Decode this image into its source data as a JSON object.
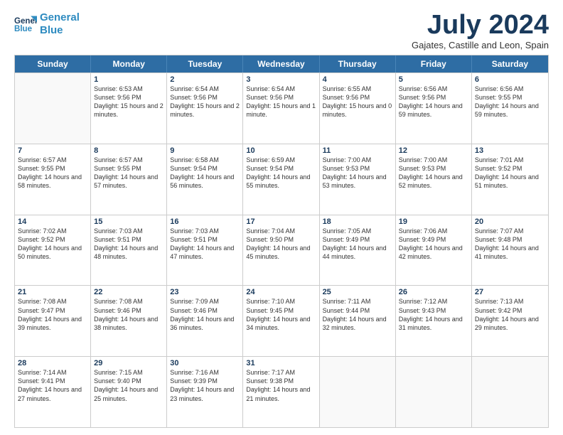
{
  "header": {
    "logo_line1": "General",
    "logo_line2": "Blue",
    "month_title": "July 2024",
    "location": "Gajates, Castille and Leon, Spain"
  },
  "weekdays": [
    "Sunday",
    "Monday",
    "Tuesday",
    "Wednesday",
    "Thursday",
    "Friday",
    "Saturday"
  ],
  "rows": [
    [
      {
        "day": "",
        "sunrise": "",
        "sunset": "",
        "daylight": ""
      },
      {
        "day": "1",
        "sunrise": "Sunrise: 6:53 AM",
        "sunset": "Sunset: 9:56 PM",
        "daylight": "Daylight: 15 hours and 2 minutes."
      },
      {
        "day": "2",
        "sunrise": "Sunrise: 6:54 AM",
        "sunset": "Sunset: 9:56 PM",
        "daylight": "Daylight: 15 hours and 2 minutes."
      },
      {
        "day": "3",
        "sunrise": "Sunrise: 6:54 AM",
        "sunset": "Sunset: 9:56 PM",
        "daylight": "Daylight: 15 hours and 1 minute."
      },
      {
        "day": "4",
        "sunrise": "Sunrise: 6:55 AM",
        "sunset": "Sunset: 9:56 PM",
        "daylight": "Daylight: 15 hours and 0 minutes."
      },
      {
        "day": "5",
        "sunrise": "Sunrise: 6:56 AM",
        "sunset": "Sunset: 9:56 PM",
        "daylight": "Daylight: 14 hours and 59 minutes."
      },
      {
        "day": "6",
        "sunrise": "Sunrise: 6:56 AM",
        "sunset": "Sunset: 9:55 PM",
        "daylight": "Daylight: 14 hours and 59 minutes."
      }
    ],
    [
      {
        "day": "7",
        "sunrise": "Sunrise: 6:57 AM",
        "sunset": "Sunset: 9:55 PM",
        "daylight": "Daylight: 14 hours and 58 minutes."
      },
      {
        "day": "8",
        "sunrise": "Sunrise: 6:57 AM",
        "sunset": "Sunset: 9:55 PM",
        "daylight": "Daylight: 14 hours and 57 minutes."
      },
      {
        "day": "9",
        "sunrise": "Sunrise: 6:58 AM",
        "sunset": "Sunset: 9:54 PM",
        "daylight": "Daylight: 14 hours and 56 minutes."
      },
      {
        "day": "10",
        "sunrise": "Sunrise: 6:59 AM",
        "sunset": "Sunset: 9:54 PM",
        "daylight": "Daylight: 14 hours and 55 minutes."
      },
      {
        "day": "11",
        "sunrise": "Sunrise: 7:00 AM",
        "sunset": "Sunset: 9:53 PM",
        "daylight": "Daylight: 14 hours and 53 minutes."
      },
      {
        "day": "12",
        "sunrise": "Sunrise: 7:00 AM",
        "sunset": "Sunset: 9:53 PM",
        "daylight": "Daylight: 14 hours and 52 minutes."
      },
      {
        "day": "13",
        "sunrise": "Sunrise: 7:01 AM",
        "sunset": "Sunset: 9:52 PM",
        "daylight": "Daylight: 14 hours and 51 minutes."
      }
    ],
    [
      {
        "day": "14",
        "sunrise": "Sunrise: 7:02 AM",
        "sunset": "Sunset: 9:52 PM",
        "daylight": "Daylight: 14 hours and 50 minutes."
      },
      {
        "day": "15",
        "sunrise": "Sunrise: 7:03 AM",
        "sunset": "Sunset: 9:51 PM",
        "daylight": "Daylight: 14 hours and 48 minutes."
      },
      {
        "day": "16",
        "sunrise": "Sunrise: 7:03 AM",
        "sunset": "Sunset: 9:51 PM",
        "daylight": "Daylight: 14 hours and 47 minutes."
      },
      {
        "day": "17",
        "sunrise": "Sunrise: 7:04 AM",
        "sunset": "Sunset: 9:50 PM",
        "daylight": "Daylight: 14 hours and 45 minutes."
      },
      {
        "day": "18",
        "sunrise": "Sunrise: 7:05 AM",
        "sunset": "Sunset: 9:49 PM",
        "daylight": "Daylight: 14 hours and 44 minutes."
      },
      {
        "day": "19",
        "sunrise": "Sunrise: 7:06 AM",
        "sunset": "Sunset: 9:49 PM",
        "daylight": "Daylight: 14 hours and 42 minutes."
      },
      {
        "day": "20",
        "sunrise": "Sunrise: 7:07 AM",
        "sunset": "Sunset: 9:48 PM",
        "daylight": "Daylight: 14 hours and 41 minutes."
      }
    ],
    [
      {
        "day": "21",
        "sunrise": "Sunrise: 7:08 AM",
        "sunset": "Sunset: 9:47 PM",
        "daylight": "Daylight: 14 hours and 39 minutes."
      },
      {
        "day": "22",
        "sunrise": "Sunrise: 7:08 AM",
        "sunset": "Sunset: 9:46 PM",
        "daylight": "Daylight: 14 hours and 38 minutes."
      },
      {
        "day": "23",
        "sunrise": "Sunrise: 7:09 AM",
        "sunset": "Sunset: 9:46 PM",
        "daylight": "Daylight: 14 hours and 36 minutes."
      },
      {
        "day": "24",
        "sunrise": "Sunrise: 7:10 AM",
        "sunset": "Sunset: 9:45 PM",
        "daylight": "Daylight: 14 hours and 34 minutes."
      },
      {
        "day": "25",
        "sunrise": "Sunrise: 7:11 AM",
        "sunset": "Sunset: 9:44 PM",
        "daylight": "Daylight: 14 hours and 32 minutes."
      },
      {
        "day": "26",
        "sunrise": "Sunrise: 7:12 AM",
        "sunset": "Sunset: 9:43 PM",
        "daylight": "Daylight: 14 hours and 31 minutes."
      },
      {
        "day": "27",
        "sunrise": "Sunrise: 7:13 AM",
        "sunset": "Sunset: 9:42 PM",
        "daylight": "Daylight: 14 hours and 29 minutes."
      }
    ],
    [
      {
        "day": "28",
        "sunrise": "Sunrise: 7:14 AM",
        "sunset": "Sunset: 9:41 PM",
        "daylight": "Daylight: 14 hours and 27 minutes."
      },
      {
        "day": "29",
        "sunrise": "Sunrise: 7:15 AM",
        "sunset": "Sunset: 9:40 PM",
        "daylight": "Daylight: 14 hours and 25 minutes."
      },
      {
        "day": "30",
        "sunrise": "Sunrise: 7:16 AM",
        "sunset": "Sunset: 9:39 PM",
        "daylight": "Daylight: 14 hours and 23 minutes."
      },
      {
        "day": "31",
        "sunrise": "Sunrise: 7:17 AM",
        "sunset": "Sunset: 9:38 PM",
        "daylight": "Daylight: 14 hours and 21 minutes."
      },
      {
        "day": "",
        "sunrise": "",
        "sunset": "",
        "daylight": ""
      },
      {
        "day": "",
        "sunrise": "",
        "sunset": "",
        "daylight": ""
      },
      {
        "day": "",
        "sunrise": "",
        "sunset": "",
        "daylight": ""
      }
    ]
  ]
}
